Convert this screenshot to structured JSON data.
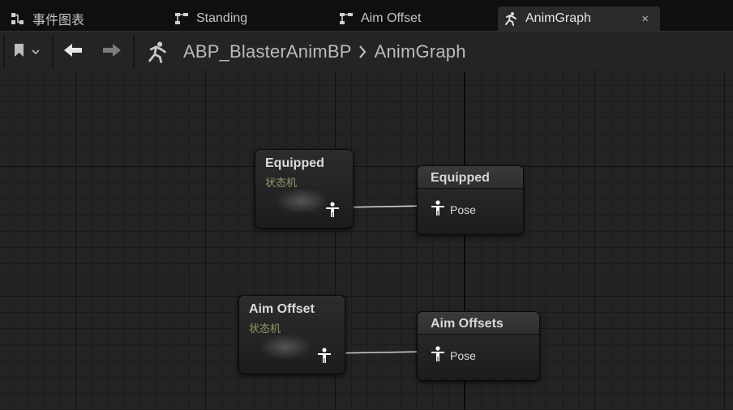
{
  "tabs": [
    {
      "label": "事件图表",
      "icon": "event-graph-icon",
      "active": false
    },
    {
      "label": "Standing",
      "icon": "state-machine-icon",
      "active": false
    },
    {
      "label": "Aim Offset",
      "icon": "state-machine-icon",
      "active": false
    },
    {
      "label": "AnimGraph",
      "icon": "anim-graph-icon",
      "active": true,
      "close_label": "×"
    }
  ],
  "toolbar": {
    "breadcrumb": [
      "ABP_BlasterAnimBP",
      "AnimGraph"
    ],
    "separator": "›"
  },
  "nodes": {
    "sm_equipped": {
      "title": "Equipped",
      "subtitle": "状态机"
    },
    "res_equipped": {
      "title": "Equipped",
      "pin": "Pose"
    },
    "sm_aim": {
      "title": "Aim Offset",
      "subtitle": "状态机"
    },
    "res_aim": {
      "title": "Aim Offsets",
      "pin": "Pose"
    }
  },
  "colors": {
    "tab_active_bg": "#2a2a2a",
    "subtitle": "#8f9a6a",
    "wire": "#d0d0d0"
  }
}
